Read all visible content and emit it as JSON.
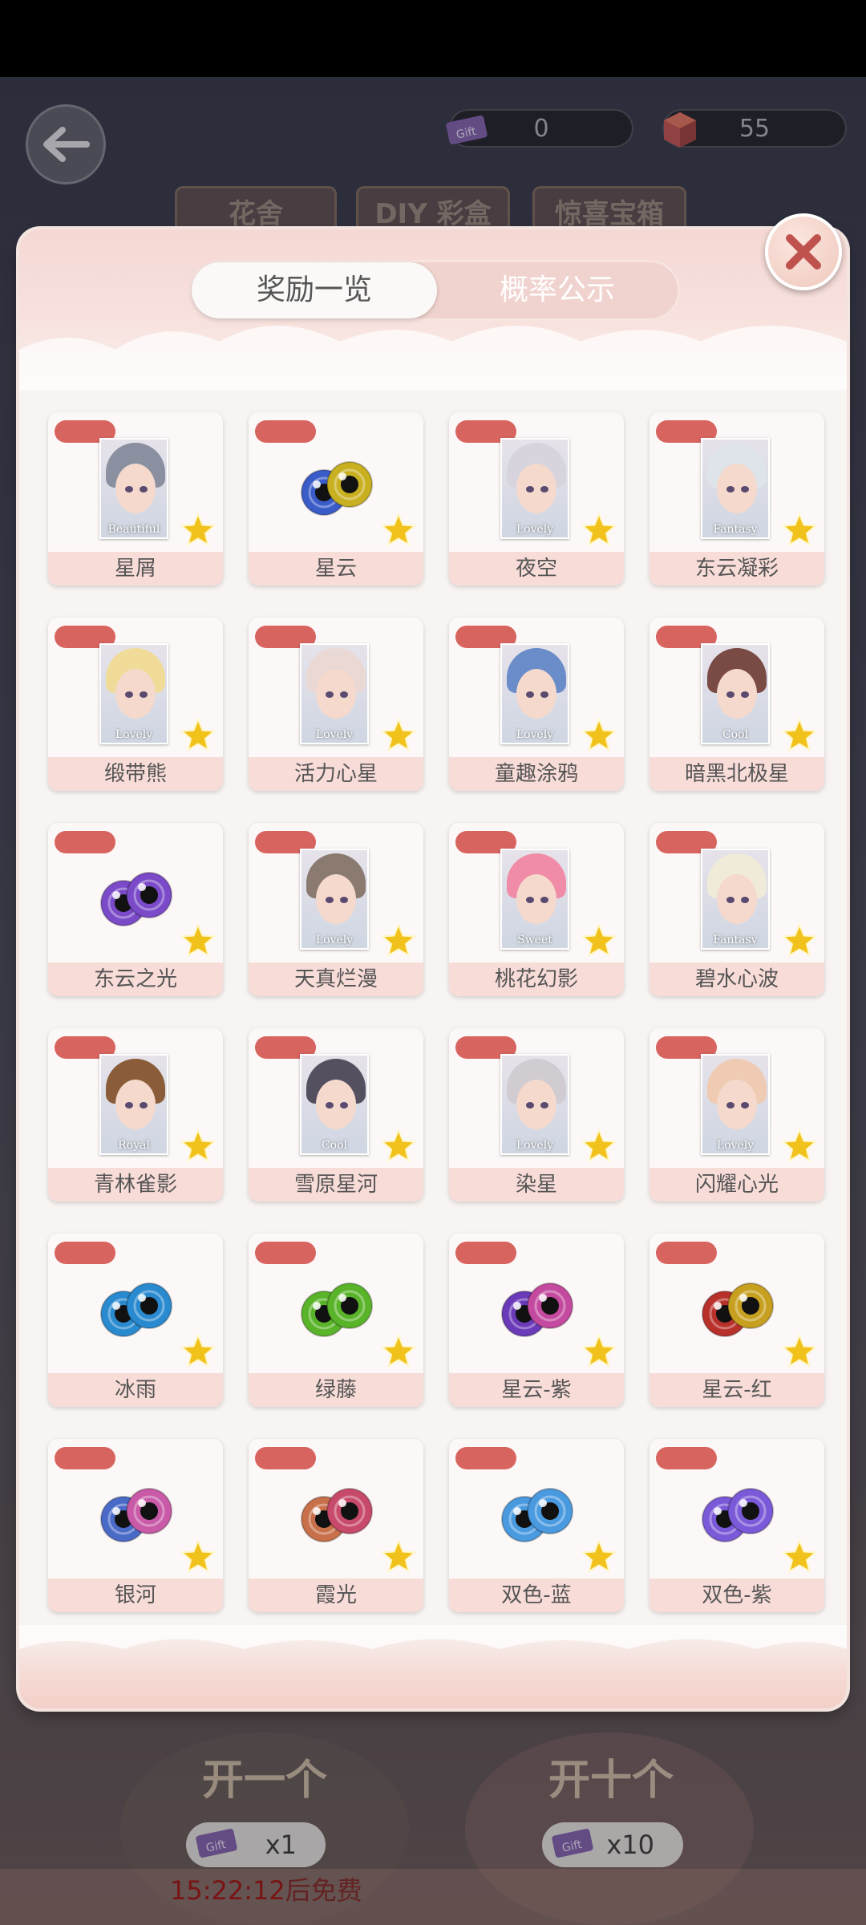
{
  "header": {
    "currency_ticket": "0",
    "currency_gem": "55",
    "bg_tabs": [
      "花舍",
      "DIY 彩盒",
      "惊喜宝箱"
    ]
  },
  "panel": {
    "tabs": [
      {
        "label": "奖励一览",
        "active": true
      },
      {
        "label": "概率公示",
        "active": false
      }
    ],
    "items": [
      {
        "name": "星屑",
        "kind": "portrait",
        "tag": "Beautiful",
        "hair": "#8a90a0"
      },
      {
        "name": "星云",
        "kind": "lens",
        "iris": "#3a5cc8",
        "iris2": "#c8b020"
      },
      {
        "name": "夜空",
        "kind": "portrait",
        "tag": "Lovely",
        "hair": "#d8d4de"
      },
      {
        "name": "东云凝彩",
        "kind": "portrait",
        "tag": "Fantasy",
        "hair": "#dfe4ea"
      },
      {
        "name": "缎带熊",
        "kind": "portrait",
        "tag": "Lovely",
        "hair": "#f0dc98"
      },
      {
        "name": "活力心星",
        "kind": "portrait",
        "tag": "Lovely",
        "hair": "#ead8d4"
      },
      {
        "name": "童趣涂鸦",
        "kind": "portrait",
        "tag": "Lovely",
        "hair": "#6a8cc8"
      },
      {
        "name": "暗黑北极星",
        "kind": "portrait",
        "tag": "Cool",
        "hair": "#7a4a44"
      },
      {
        "name": "东云之光",
        "kind": "lens",
        "iris": "#7a4ac8",
        "iris2": "#7a4ac8"
      },
      {
        "name": "天真烂漫",
        "kind": "portrait",
        "tag": "Lovely",
        "hair": "#8a7a70"
      },
      {
        "name": "桃花幻影",
        "kind": "portrait",
        "tag": "Sweet",
        "hair": "#f08ca8"
      },
      {
        "name": "碧水心波",
        "kind": "portrait",
        "tag": "Fantasy",
        "hair": "#f0ead8"
      },
      {
        "name": "青林雀影",
        "kind": "portrait",
        "tag": "Royal",
        "hair": "#8a5c3a"
      },
      {
        "name": "雪原星河",
        "kind": "portrait",
        "tag": "Cool",
        "hair": "#555060"
      },
      {
        "name": "染星",
        "kind": "portrait",
        "tag": "Lovely",
        "hair": "#d0ccd2"
      },
      {
        "name": "闪耀心光",
        "kind": "portrait",
        "tag": "Lovely",
        "hair": "#f0cbb4"
      },
      {
        "name": "冰雨",
        "kind": "lens",
        "iris": "#2a8ad0",
        "iris2": "#2a8ad0"
      },
      {
        "name": "绿藤",
        "kind": "lens",
        "iris": "#5ab42a",
        "iris2": "#5ab42a"
      },
      {
        "name": "星云-紫",
        "kind": "lens",
        "iris": "#6a3ab8",
        "iris2": "#c44aa0"
      },
      {
        "name": "星云-红",
        "kind": "lens",
        "iris": "#b8302a",
        "iris2": "#c8a020"
      },
      {
        "name": "银河",
        "kind": "lens",
        "iris": "#4a6ac8",
        "iris2": "#c85aa8"
      },
      {
        "name": "霞光",
        "kind": "lens",
        "iris": "#c8704a",
        "iris2": "#c84a6a"
      },
      {
        "name": "双色-蓝",
        "kind": "lens",
        "iris": "#4a9ae0",
        "iris2": "#4a9ae0"
      },
      {
        "name": "双色-紫",
        "kind": "lens",
        "iris": "#7a5ad8",
        "iris2": "#7a5ad8"
      }
    ]
  },
  "bottom": {
    "open_one_label": "开一个",
    "open_ten_label": "开十个",
    "cost_one": "x1",
    "cost_ten": "x10",
    "timer_value": "15:22:12",
    "timer_suffix": "后免费"
  },
  "colors": {
    "tag_red": "#d86460",
    "label_bg": "#f8dcd8",
    "star_gold": "#f2c21c"
  },
  "icons": {
    "back": "arrow-left-icon",
    "close": "close-icon",
    "ticket": "ticket-icon",
    "gem": "gem-cube-icon",
    "star": "star-icon"
  }
}
